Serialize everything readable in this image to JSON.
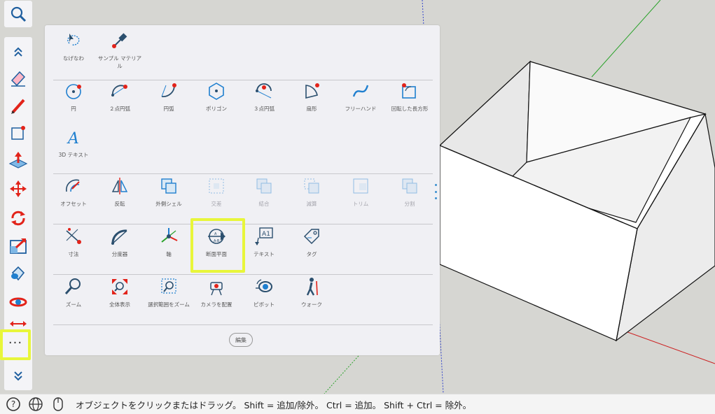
{
  "panel": {
    "rows": [
      [
        {
          "label": "なげなわ",
          "icon": "lasso-icon",
          "dim": false
        },
        {
          "label": "サンプル マテリアル",
          "icon": "eyedropper-icon",
          "dim": false
        }
      ],
      [
        {
          "label": "円",
          "icon": "circle-icon",
          "dim": false
        },
        {
          "label": "２点円弧",
          "icon": "two-point-arc-icon",
          "dim": false
        },
        {
          "label": "円弧",
          "icon": "arc-icon",
          "dim": false
        },
        {
          "label": "ポリゴン",
          "icon": "polygon-icon",
          "dim": false
        },
        {
          "label": "３点円弧",
          "icon": "three-point-arc-icon",
          "dim": false
        },
        {
          "label": "扇形",
          "icon": "pie-icon",
          "dim": false
        },
        {
          "label": "フリーハンド",
          "icon": "freehand-icon",
          "dim": false
        },
        {
          "label": "回転した長方形",
          "icon": "rotated-rectangle-icon",
          "dim": false
        }
      ],
      [
        {
          "label": "3D テキスト",
          "icon": "3d-text-icon",
          "dim": false
        }
      ],
      [
        {
          "label": "オフセット",
          "icon": "offset-icon",
          "dim": false
        },
        {
          "label": "反転",
          "icon": "flip-icon",
          "dim": false
        },
        {
          "label": "外側シェル",
          "icon": "outer-shell-icon",
          "dim": false
        },
        {
          "label": "交差",
          "icon": "intersect-icon",
          "dim": true
        },
        {
          "label": "結合",
          "icon": "union-icon",
          "dim": true
        },
        {
          "label": "減算",
          "icon": "subtract-icon",
          "dim": true
        },
        {
          "label": "トリム",
          "icon": "trim-icon",
          "dim": true
        },
        {
          "label": "分割",
          "icon": "split-icon",
          "dim": true
        }
      ],
      [
        {
          "label": "寸法",
          "icon": "dimension-icon",
          "dim": false
        },
        {
          "label": "分度器",
          "icon": "protractor-icon",
          "dim": false
        },
        {
          "label": "軸",
          "icon": "axes-icon",
          "dim": false
        },
        {
          "label": "断面平面",
          "icon": "section-plane-icon",
          "dim": false
        },
        {
          "label": "テキスト",
          "icon": "text-icon",
          "dim": false
        },
        {
          "label": "タグ",
          "icon": "tag-icon",
          "dim": false
        }
      ],
      [
        {
          "label": "ズーム",
          "icon": "zoom-icon",
          "dim": false
        },
        {
          "label": "全体表示",
          "icon": "zoom-extents-icon",
          "dim": false
        },
        {
          "label": "選択範囲をズーム",
          "icon": "zoom-selection-icon",
          "dim": false
        },
        {
          "label": "カメラを配置",
          "icon": "position-camera-icon",
          "dim": false
        },
        {
          "label": "ピボット",
          "icon": "pivot-icon",
          "dim": false
        },
        {
          "label": "ウォーク",
          "icon": "walk-icon",
          "dim": false
        }
      ]
    ],
    "edit_label": "編集"
  },
  "sidebar": {
    "items": [
      "collapse-up-icon",
      "eraser-icon",
      "pencil-icon",
      "rectangle-icon",
      "push-pull-icon",
      "move-icon",
      "rotate-icon",
      "scale-icon",
      "paint-bucket-icon",
      "orbit-icon",
      "pan-icon"
    ],
    "more_label": "···"
  },
  "statusbar": {
    "text": "オブジェクトをクリックまたはドラッグ。 Shift = 追加/除外。 Ctrl = 追加。 Shift + Ctrl = 除外。"
  },
  "colors": {
    "accent": "#1f7fcf",
    "red": "#e2231a",
    "highlight": "#e8f63a",
    "dark_icon": "#2b4f6e"
  }
}
